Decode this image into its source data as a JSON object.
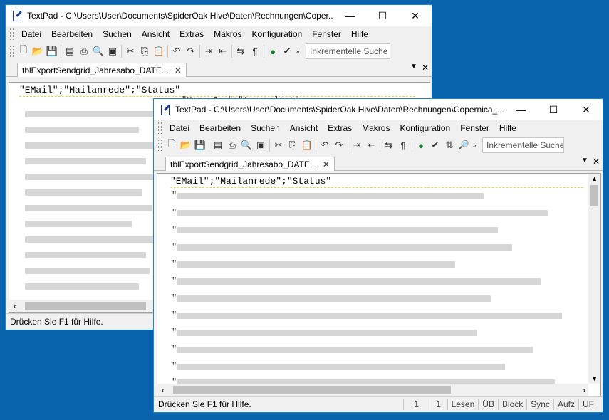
{
  "back_window": {
    "title": "TextPad - C:\\Users\\User\\Documents\\SpiderOak Hive\\Daten\\Rechnungen\\Coper...",
    "tab_label": "tblExportSendgrid_Jahresabo_DATE...",
    "first_line": "\"EMail\";\"Mailanrede\";\"Status\"",
    "second_line_partial": "\"Herr Jan\";\"Angemeldet\"",
    "search_placeholder": "Inkrementelle Suche",
    "status_text": "Drücken Sie F1 für Hilfe."
  },
  "front_window": {
    "title": "TextPad - C:\\Users\\User\\Documents\\SpiderOak Hive\\Daten\\Rechnungen\\Copernica_...",
    "tab_label": "tblExportSendgrid_Jahresabo_DATE...",
    "first_line": "\"EMail\";\"Mailanrede\";\"Status\"",
    "search_placeholder": "Inkrementelle Suche",
    "status_text": "Drücken Sie F1 für Hilfe.",
    "status_cells": [
      "1",
      "1",
      "Lesen",
      "ÜB",
      "Block",
      "Sync",
      "Aufz",
      "UF"
    ]
  },
  "menu": [
    "Datei",
    "Bearbeiten",
    "Suchen",
    "Ansicht",
    "Extras",
    "Makros",
    "Konfiguration",
    "Fenster",
    "Hilfe"
  ],
  "window_controls": {
    "minimize": "—",
    "maximize": "☐",
    "close": "✕"
  },
  "toolbar_icons": [
    "new-icon",
    "open-icon",
    "save-icon",
    "save-all-icon",
    "print-icon",
    "print-preview-icon",
    "spell-icon",
    "cut-icon",
    "copy-icon",
    "paste-icon",
    "undo-icon",
    "redo-icon",
    "indent-icon",
    "outdent-icon",
    "word-wrap-icon",
    "pilcrow-icon",
    "web-icon",
    "spellcheck-icon",
    "sort-icon",
    "find-icon"
  ],
  "colors": {
    "desktop": "#0a64ad",
    "window_border": "#1883d7",
    "chrome": "#f0f0f0"
  }
}
